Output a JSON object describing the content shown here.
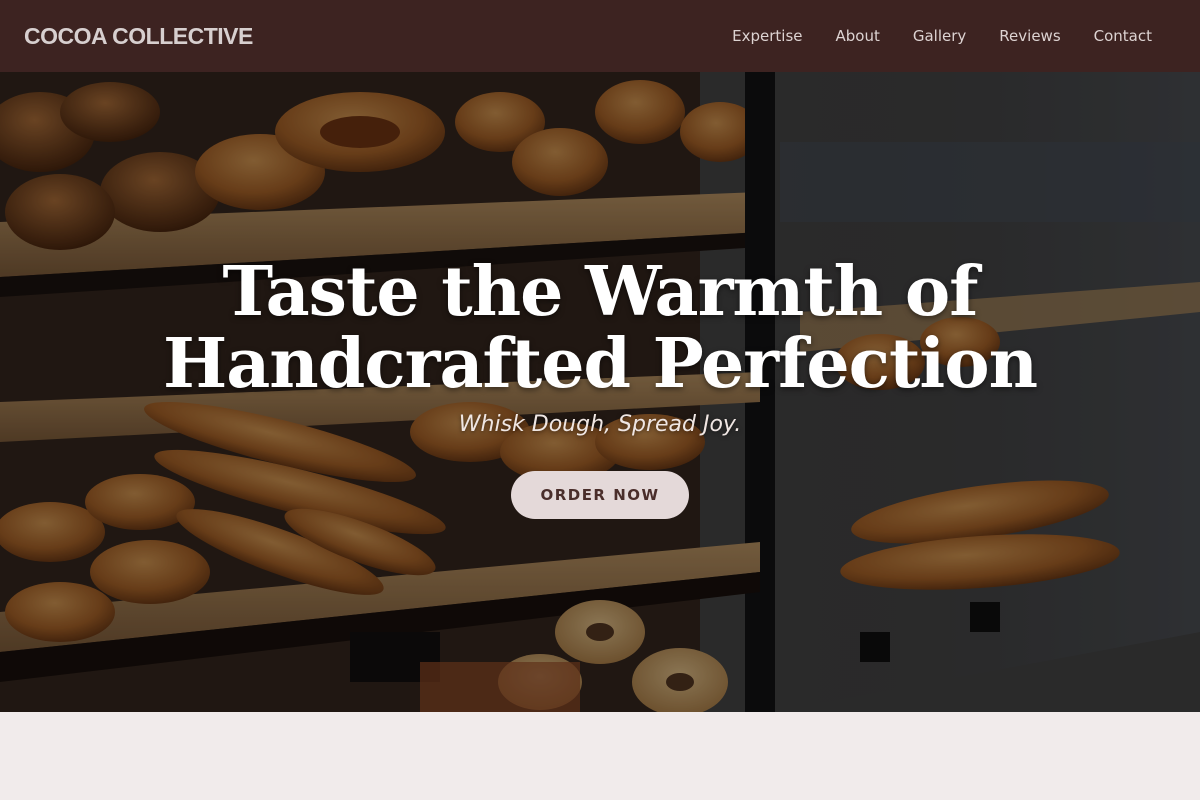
{
  "nav": {
    "brand": "COCOA COLLECTIVE",
    "links": [
      "Expertise",
      "About",
      "Gallery",
      "Reviews",
      "Contact"
    ]
  },
  "hero": {
    "title": "Taste the Warmth of Handcrafted Perfection",
    "tagline": "Whisk Dough, Spread Joy.",
    "cta_label": "ORDER NOW",
    "background_image": "bakery-display-case-photo"
  },
  "colors": {
    "nav_bg": "#3d2321",
    "cta_bg": "#e4d9d9",
    "cta_text": "#4a2e2b",
    "section_bg": "#f1ebeb"
  }
}
